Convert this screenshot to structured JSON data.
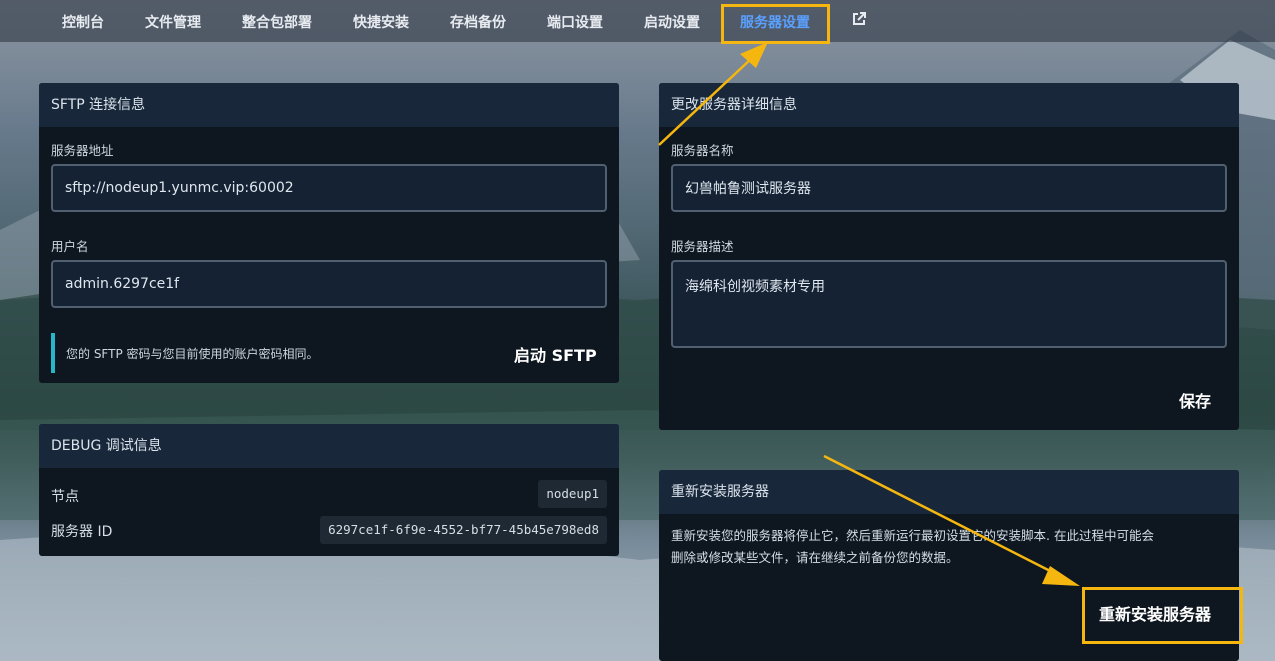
{
  "nav": {
    "items": [
      "控制台",
      "文件管理",
      "整合包部署",
      "快捷安装",
      "存档备份",
      "端口设置",
      "启动设置",
      "服务器设置"
    ],
    "active_index": 7,
    "external_icon": "external-link-icon"
  },
  "sftp": {
    "title": "SFTP 连接信息",
    "address_label": "服务器地址",
    "address_value": "sftp://nodeup1.yunmc.vip:60002",
    "username_label": "用户名",
    "username_value": "admin.6297ce1f",
    "note": "您的 SFTP 密码与您目前使用的账户密码相同。",
    "launch_label": "启动 SFTP"
  },
  "debug": {
    "title": "DEBUG 调试信息",
    "node_label": "节点",
    "node_value": "nodeup1",
    "id_label": "服务器 ID",
    "id_value": "6297ce1f-6f9e-4552-bf77-45b45e798ed8"
  },
  "details": {
    "title": "更改服务器详细信息",
    "name_label": "服务器名称",
    "name_value": "幻兽帕鲁测试服务器",
    "desc_label": "服务器描述",
    "desc_value": "海绵科创视频素材专用",
    "save_label": "保存"
  },
  "reinstall": {
    "title": "重新安装服务器",
    "text_line1": "重新安装您的服务器将停止它，然后重新运行最初设置它的安装脚本. 在此过程中可能会",
    "text_line2": "删除或修改某些文件，请在继续之前备份您的数据。",
    "button_label": "重新安装服务器"
  },
  "colors": {
    "accent": "#5aa0ff",
    "highlight": "#f5b60f",
    "note_bar": "#26b6c8"
  }
}
